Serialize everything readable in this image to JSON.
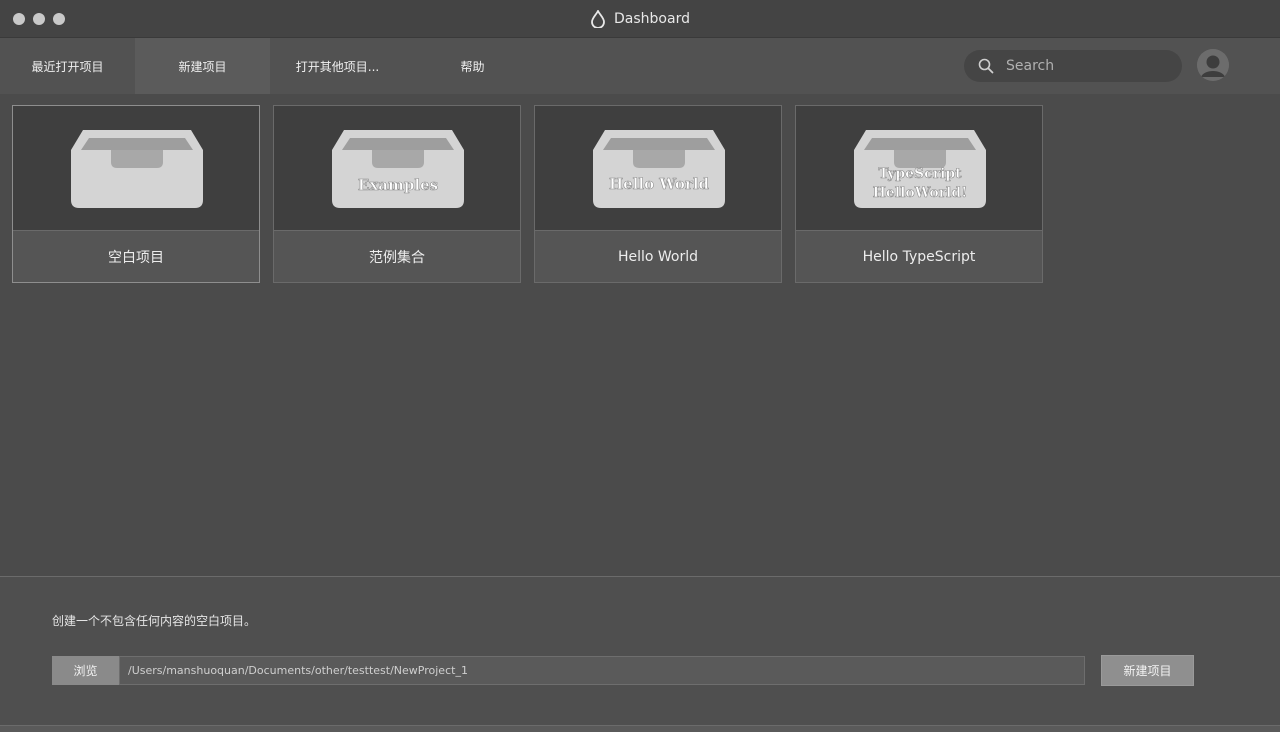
{
  "window": {
    "title": "Dashboard"
  },
  "tabs": [
    {
      "label": "最近打开项目",
      "active": false
    },
    {
      "label": "新建项目",
      "active": true
    },
    {
      "label": "打开其他项目...",
      "active": false
    },
    {
      "label": "帮助",
      "active": false
    }
  ],
  "search": {
    "placeholder": "Search"
  },
  "templates": [
    {
      "name": "空白项目",
      "thumb_text": "",
      "selected": true
    },
    {
      "name": "范例集合",
      "thumb_text": "Examples",
      "selected": false
    },
    {
      "name": "Hello World",
      "thumb_text": "Hello World",
      "selected": false
    },
    {
      "name": "Hello TypeScript",
      "thumb_text_line1": "TypeScript",
      "thumb_text_line2": "HelloWorld!",
      "selected": false
    }
  ],
  "bottom": {
    "description": "创建一个不包含任何内容的空白项目。",
    "browse_label": "浏览",
    "path_value": "/Users/manshuoquan/Documents/other/testtest/NewProject_1",
    "create_label": "新建项目"
  },
  "colors": {
    "background": "#4b4b4b",
    "toolbar": "#525252",
    "active_tab": "#5b5b5b",
    "thumb_bg": "#3f3f3f",
    "icon_fill": "#d0d0d0"
  }
}
